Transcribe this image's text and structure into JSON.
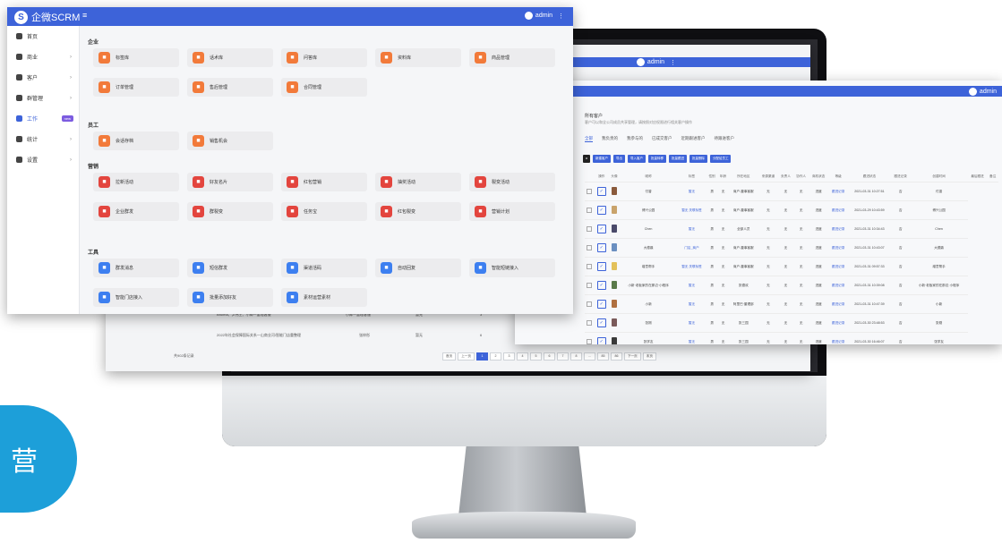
{
  "badge": "营",
  "back_window": {
    "admin": "admin",
    "rows": [
      {
        "name": "Bruima、尹伟王、小卿一董理客服",
        "type": "小卿一董理客服",
        "status": "暂无",
        "count": "3"
      },
      {
        "name": "2022年社会保障国际关系一山商业河/智能门店重整理",
        "type": "张梓彤",
        "status": "暂无",
        "count": "6"
      }
    ],
    "footer": "共902条记录",
    "pager": [
      "首页",
      "上一页",
      "1",
      "2",
      "3",
      "4",
      "5",
      "6",
      "7",
      "8",
      "...",
      "85",
      "86",
      "下一页",
      "末页"
    ]
  },
  "mid_window": {
    "admin": "admin",
    "title": "所有客户",
    "subtitle": "客户可以和全公司成员共享管理，请按照对应权限进行相关客户操作",
    "tabs": [
      "全部",
      "我负责的",
      "我参与的",
      "已成交客户",
      "近期跟进客户",
      "待跟进客户"
    ],
    "buttons": [
      "a",
      "新建客户",
      "导出",
      "导入客户",
      "批量转移",
      "批量跟进",
      "批量删除",
      "分配给员工"
    ],
    "table": {
      "columns": [
        "",
        "操作",
        "头像",
        "昵称",
        "标签",
        "性别",
        "年龄",
        "所在地区",
        "来源渠道",
        "负责人",
        "协作人",
        "商机状态",
        "等级",
        "跟进状态",
        "跟进记录",
        "创建时间",
        "最后跟进",
        "备注"
      ],
      "rows": [
        [
          "付香",
          "暂无",
          "男",
          "无",
          "商户-董事客服",
          "无",
          "无",
          "无",
          "进度",
          "跟进记录",
          "2021-03-31 10:27:51",
          "否",
          "付香"
        ],
        [
          "博兴公园",
          "暂无 关联标签",
          "男",
          "无",
          "商户-董事客服",
          "无",
          "无",
          "无",
          "进度",
          "跟进记录",
          "2021-03-29 10:43:59",
          "否",
          "博兴公园"
        ],
        [
          "Chen",
          "暂无",
          "男",
          "无",
          "全部人员",
          "无",
          "无",
          "无",
          "进度",
          "跟进记录",
          "2021-03-31 10:34:43",
          "否",
          "Chen"
        ],
        [
          "大德鼎",
          "门店_商户",
          "男",
          "无",
          "商户-董事客服",
          "无",
          "无",
          "无",
          "进度",
          "跟进记录",
          "2021-03-31 10:43:07",
          "否",
          "大德鼎"
        ],
        [
          "增意帮手",
          "暂无 关联标签",
          "男",
          "无",
          "商户-董事客服",
          "无",
          "无",
          "无",
          "进度",
          "跟进记录",
          "2021-03-31 09:57:33",
          "否",
          "增意帮手"
        ],
        [
          "小新·老板家的在那边·小程序",
          "暂无",
          "男",
          "无",
          "张德欢",
          "无",
          "无",
          "无",
          "进度",
          "跟进记录",
          "2021-03-31 10:39:08",
          "否",
          "小新·老板家的在那边·小程序"
        ],
        [
          "小新",
          "暂无",
          "男",
          "无",
          "阿里巴·董理部",
          "无",
          "无",
          "无",
          "进度",
          "跟进记录",
          "2021-03-31 10:47:39",
          "否",
          "小新"
        ],
        [
          "张刚",
          "暂无",
          "男",
          "无",
          "张三园",
          "无",
          "无",
          "无",
          "进度",
          "跟进记录",
          "2021-03-30 23:48:53",
          "否",
          "张刚"
        ],
        [
          "张学友",
          "暂无",
          "男",
          "无",
          "张三园",
          "无",
          "无",
          "无",
          "进度",
          "跟进记录",
          "2021-03-30 16:46:07",
          "否",
          "张学友"
        ],
        [
          "董事部",
          "暂无",
          "男",
          "无",
          "阿里巴·董理部",
          "无",
          "无",
          "无",
          "进度",
          "跟进记录",
          "2021-03-30 16:24:26",
          "否",
          "董事部"
        ]
      ]
    }
  },
  "main_window": {
    "app_name": "企微SCRM",
    "admin": "admin",
    "sidebar": [
      {
        "label": "首页",
        "arrow": false
      },
      {
        "label": "商业",
        "arrow": true
      },
      {
        "label": "客户",
        "arrow": true
      },
      {
        "label": "群管理",
        "arrow": true
      },
      {
        "label": "工作",
        "arrow": false,
        "tag": "new",
        "active": true
      },
      {
        "label": "统计",
        "arrow": true
      },
      {
        "label": "设置",
        "arrow": true
      }
    ],
    "sections": [
      {
        "title": "企业",
        "cards": [
          {
            "label": "标签库",
            "icon": "tag-icon",
            "color": "o"
          },
          {
            "label": "话术库",
            "icon": "chat-icon",
            "color": "o"
          },
          {
            "label": "问答库",
            "icon": "question-icon",
            "color": "o"
          },
          {
            "label": "资料库",
            "icon": "library-icon",
            "color": "o"
          },
          {
            "label": "商品管理",
            "icon": "shop-icon",
            "color": "o"
          },
          {
            "label": "订单管理",
            "icon": "order-icon",
            "color": "o"
          },
          {
            "label": "售后管理",
            "icon": "service-icon",
            "color": "o"
          },
          {
            "label": "合同管理",
            "icon": "contract-icon",
            "color": "o"
          }
        ]
      },
      {
        "title": "员工",
        "cards": [
          {
            "label": "会话存档",
            "icon": "archive-icon",
            "color": "o"
          },
          {
            "label": "销售机会",
            "icon": "opportunity-icon",
            "color": "o"
          }
        ]
      },
      {
        "title": "营销",
        "cards": [
          {
            "label": "拉新活动",
            "icon": "user-add-icon",
            "color": "r"
          },
          {
            "label": "好友名片",
            "icon": "card-icon",
            "color": "r"
          },
          {
            "label": "红包营销",
            "icon": "redpacket-icon",
            "color": "r"
          },
          {
            "label": "抽奖活动",
            "icon": "lottery-icon",
            "color": "r"
          },
          {
            "label": "裂变活动",
            "icon": "share-icon",
            "color": "r"
          },
          {
            "label": "企业群发",
            "icon": "broadcast-icon",
            "color": "r"
          },
          {
            "label": "群裂变",
            "icon": "group-icon",
            "color": "r"
          },
          {
            "label": "任务宝",
            "icon": "task-icon",
            "color": "r"
          },
          {
            "label": "红包裂变",
            "icon": "gift-icon",
            "color": "r"
          },
          {
            "label": "营销计划",
            "icon": "plan-icon",
            "color": "r"
          }
        ]
      },
      {
        "title": "工具",
        "cards": [
          {
            "label": "群发消息",
            "icon": "send-icon",
            "color": "b"
          },
          {
            "label": "短信群发",
            "icon": "sms-icon",
            "color": "b"
          },
          {
            "label": "渠道活码",
            "icon": "qrcode-icon",
            "color": "b"
          },
          {
            "label": "自动回复",
            "icon": "reply-icon",
            "color": "b"
          },
          {
            "label": "智能短链接入",
            "icon": "link-icon",
            "color": "b"
          },
          {
            "label": "智能门店接入",
            "icon": "store-icon",
            "color": "b"
          },
          {
            "label": "批量添加好友",
            "icon": "friends-icon",
            "color": "b"
          },
          {
            "label": "素材运营素材",
            "icon": "material-icon",
            "color": "b"
          }
        ]
      }
    ]
  }
}
